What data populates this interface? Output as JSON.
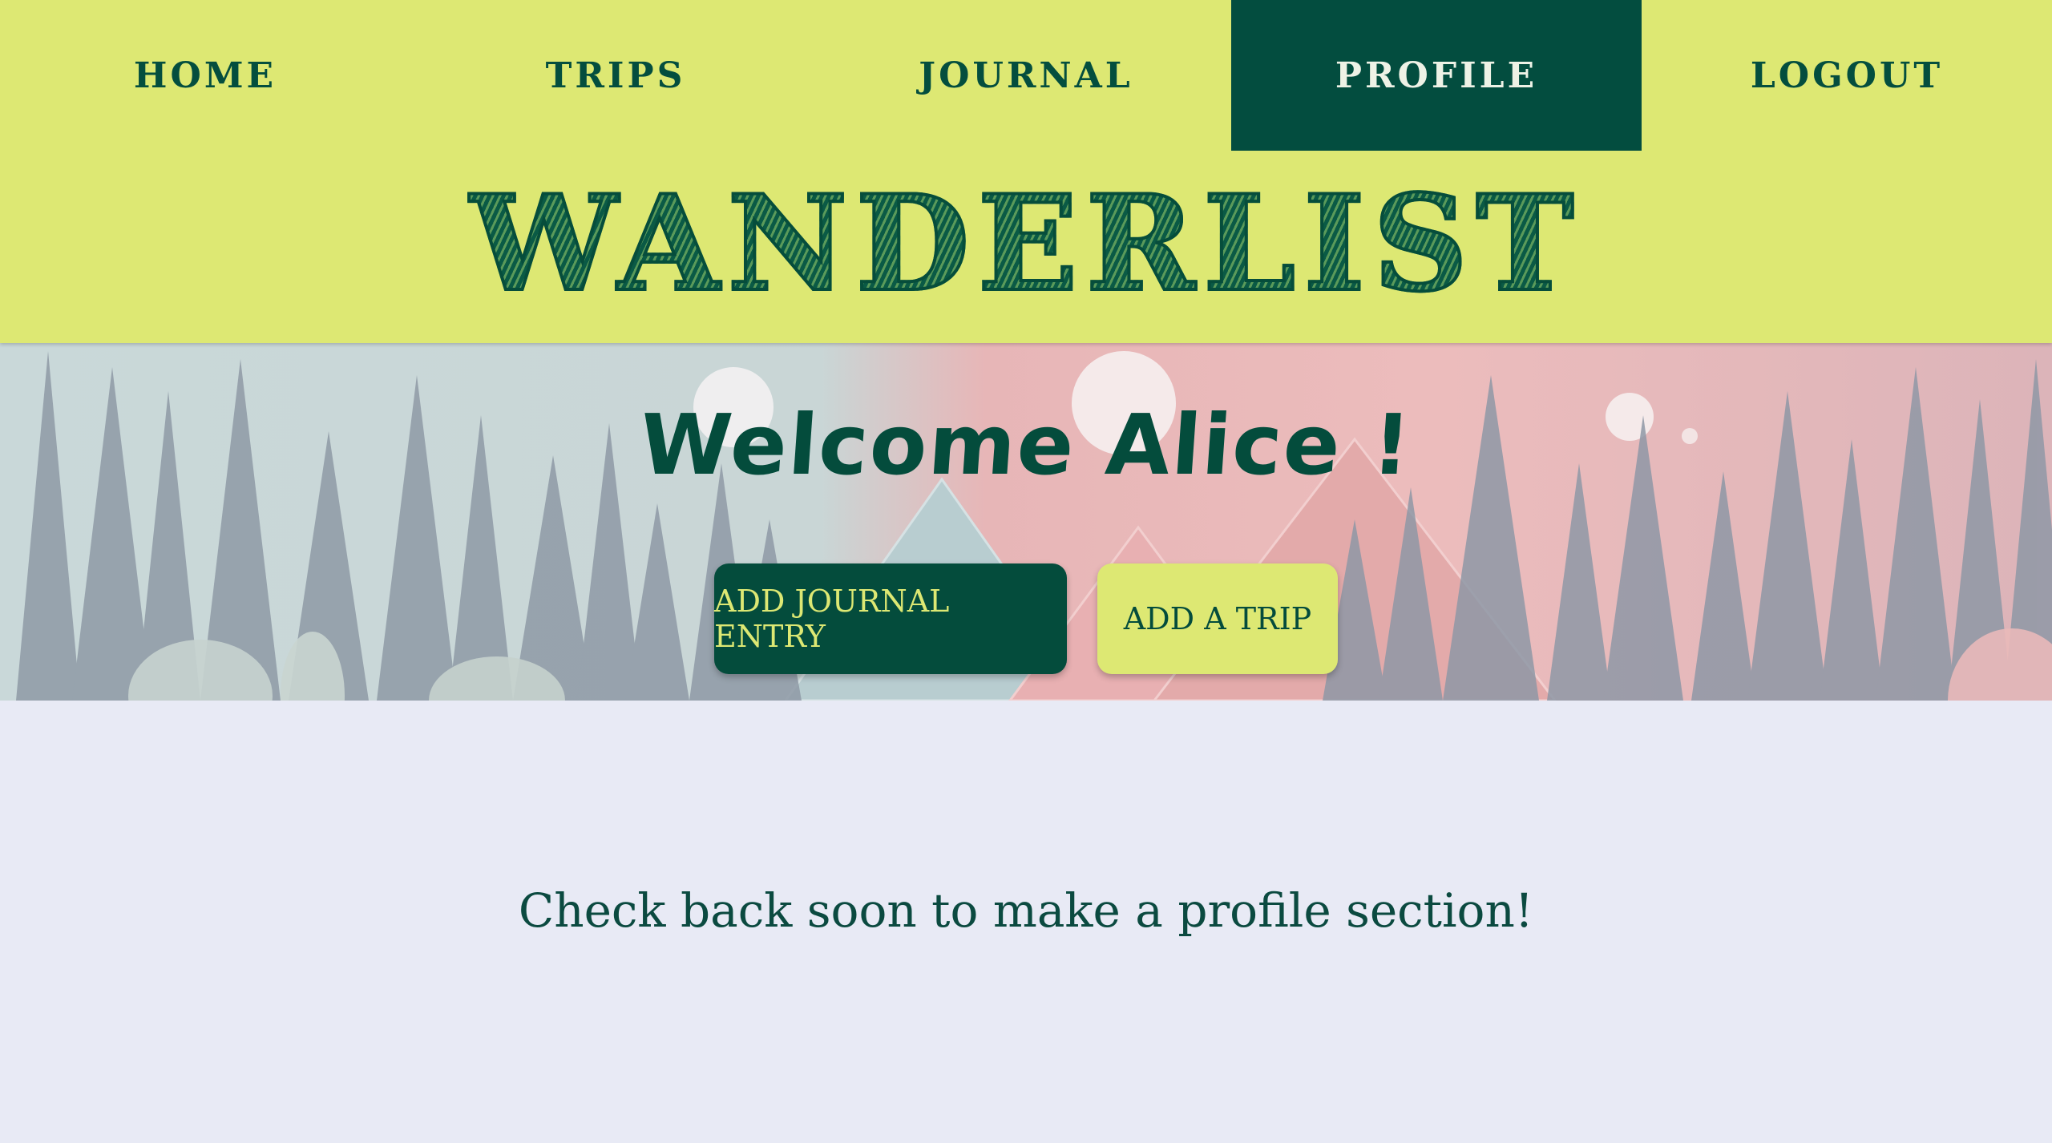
{
  "nav": {
    "items": [
      {
        "label": "HOME",
        "active": false
      },
      {
        "label": "TRIPS",
        "active": false
      },
      {
        "label": "JOURNAL",
        "active": false
      },
      {
        "label": "PROFILE",
        "active": true
      },
      {
        "label": "LOGOUT",
        "active": false
      }
    ]
  },
  "brand": {
    "title": "WANDERLIST"
  },
  "hero": {
    "welcome": "Welcome Alice !",
    "add_journal_label": "ADD JOURNAL ENTRY",
    "add_trip_label": "ADD A TRIP"
  },
  "main": {
    "message": "Check back soon to make a profile section!"
  },
  "colors": {
    "header_bg": "#dde873",
    "primary_dark": "#034d3f",
    "page_bg": "#e8eaf5"
  }
}
